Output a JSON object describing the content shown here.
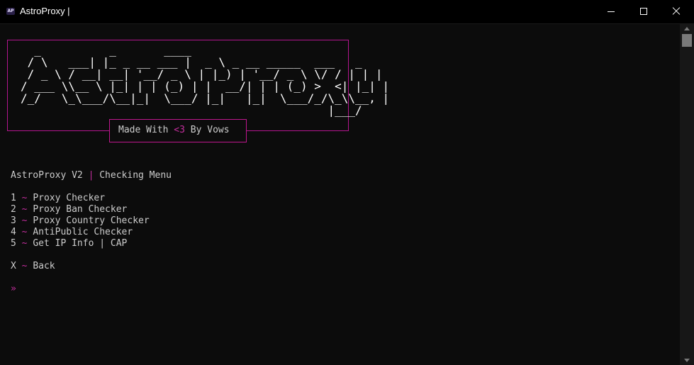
{
  "window": {
    "title": "AstroProxy |",
    "icon_label": "AP"
  },
  "banner": {
    "ascii_art": "  _          _       ____                        \n / \\   ___| |_ _ __ ___ |  _ \\ _ __ _____  ___   _ \n / _ \\ / __| __| '__/ _ \\ | |_) | '__/ _ \\ \\/ / | | |\n/ ___ \\\\__ \\ |_| | | (_) | |  __/| | | (_) >  <| |_| |\n/_/   \\_\\___/\\__|_|  \\___/ |_|   |_|  \\___/_/\\_\\\\__, |\n                                             |___/ ",
    "made_prefix": "Made With ",
    "made_heart": "<3",
    "made_suffix": " By Vows"
  },
  "menu": {
    "header_app": "AstroProxy V2 ",
    "header_sep": "|",
    "header_title": " Checking Menu",
    "separator": "~",
    "items": [
      {
        "key": "1",
        "label": "Proxy Checker"
      },
      {
        "key": "2",
        "label": "Proxy Ban Checker"
      },
      {
        "key": "3",
        "label": "Proxy Country Checker"
      },
      {
        "key": "4",
        "label": "AntiPublic Checker"
      },
      {
        "key": "5",
        "label": "Get IP Info | CAP"
      }
    ],
    "back": {
      "key": "X",
      "label": "Back"
    },
    "prompt": "»"
  },
  "colors": {
    "accent": "#c42e9e",
    "border": "#b4158f",
    "background": "#0c0c0c",
    "text": "#cccccc"
  }
}
